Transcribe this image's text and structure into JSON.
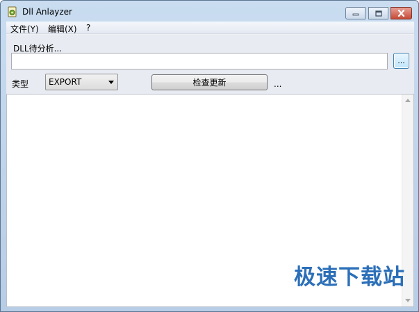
{
  "window": {
    "title": "Dll Anlayzer",
    "icon": "dll-app-icon"
  },
  "menu": {
    "items": [
      {
        "label": "文件(Y)"
      },
      {
        "label": "编辑(X)"
      },
      {
        "label": "?"
      }
    ]
  },
  "form": {
    "dll_label": "DLL待分析...",
    "path_value": "",
    "browse_label": "...",
    "type_label": "类型",
    "type_selected": "EXPORT",
    "update_button": "检查更新",
    "ellipsis": "..."
  },
  "output": {
    "content": ""
  },
  "watermark": "极速下载站",
  "colors": {
    "close_button": "#c64a37",
    "watermark": "#2b6fb8",
    "browse_button_border": "#3c7fb1"
  }
}
